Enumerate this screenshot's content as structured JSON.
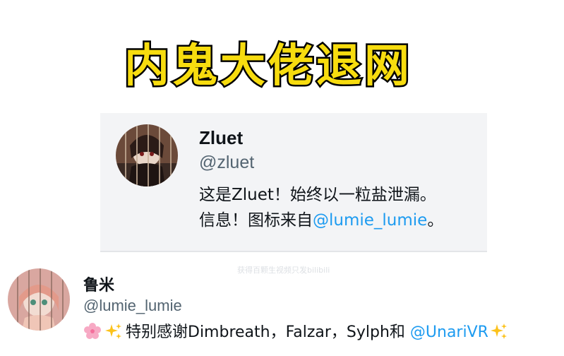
{
  "banner": {
    "title": "内鬼大佬退网"
  },
  "profile_card": {
    "name": "Zluet",
    "handle": "@zluet",
    "bio_line1": "这是Zluet！始终以一粒盐泄漏。",
    "bio_line2_prefix": "信息！图标来自",
    "bio_line2_mention": "@lumie_lumie",
    "bio_line2_suffix": "。"
  },
  "watermark": "获得百颗生视频只发bilibili",
  "post": {
    "name": "鲁米",
    "handle": "@lumie_lumie",
    "text_prefix": "特别感谢Dimbreath，Falzar，Sylph和 ",
    "mention": "@UnariVR",
    "emojis": [
      "cherry-blossom-icon",
      "sparkles-icon"
    ]
  },
  "colors": {
    "title_fill": "#f7dc0f",
    "title_stroke": "#000000",
    "mention": "#1d9bf0",
    "handle": "#536471",
    "card_bg": "#f3f4f6"
  }
}
